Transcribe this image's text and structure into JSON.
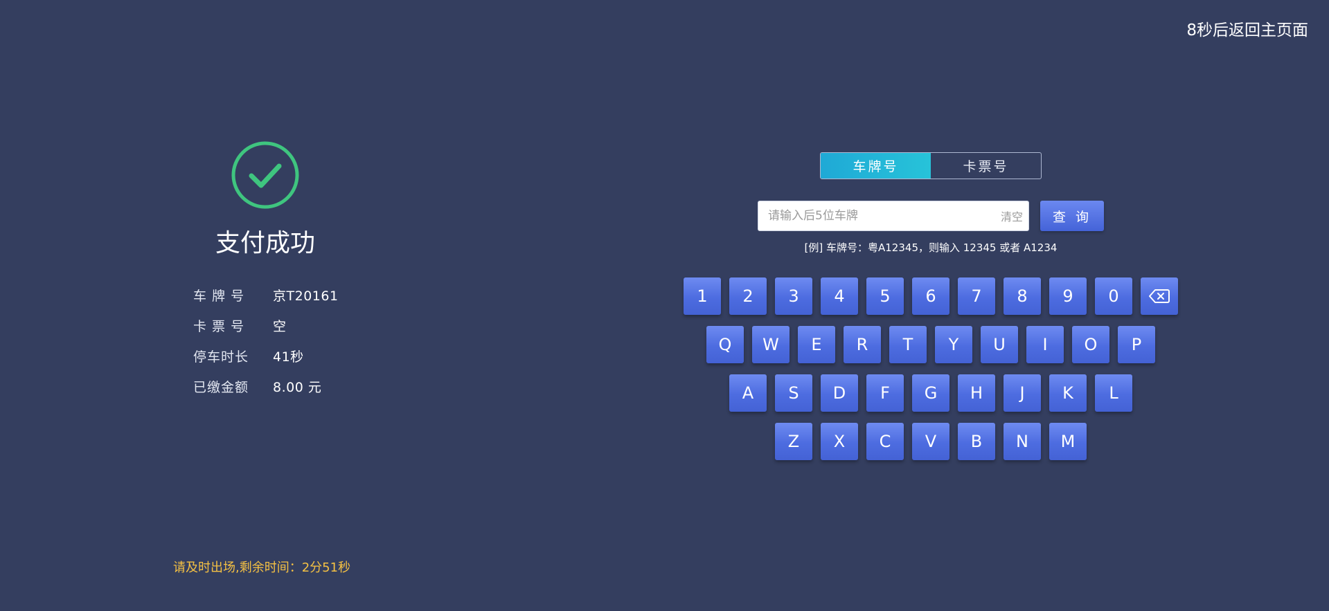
{
  "header": {
    "countdown_text": "8秒后返回主页面"
  },
  "result": {
    "status_text": "支付成功",
    "status_color": "#3fc57f",
    "details": [
      {
        "label": "车 牌 号",
        "value": "京T20161"
      },
      {
        "label": "卡 票 号",
        "value": "空"
      },
      {
        "label": "停车时长",
        "value": "41秒"
      },
      {
        "label": "已缴金额",
        "value": "8.00 元"
      }
    ],
    "exit_notice": "请及时出场,剩余时间：2分51秒",
    "exit_notice_color": "#f5c143"
  },
  "query": {
    "tabs": [
      {
        "label": "车牌号",
        "active": true
      },
      {
        "label": "卡票号",
        "active": false
      }
    ],
    "search": {
      "value": "",
      "placeholder": "请输入后5位车牌"
    },
    "clear_label": "清空",
    "query_button_label": "查 询",
    "hint": "[例] 车牌号：粤A12345，则输入 12345 或者 A1234"
  },
  "keyboard": {
    "rows": [
      [
        "1",
        "2",
        "3",
        "4",
        "5",
        "6",
        "7",
        "8",
        "9",
        "0",
        "backspace-icon"
      ],
      [
        "Q",
        "W",
        "E",
        "R",
        "T",
        "Y",
        "U",
        "I",
        "O",
        "P"
      ],
      [
        "A",
        "S",
        "D",
        "F",
        "G",
        "H",
        "J",
        "K",
        "L"
      ],
      [
        "Z",
        "X",
        "C",
        "V",
        "B",
        "N",
        "M"
      ]
    ],
    "key_color": "#5573e4"
  }
}
